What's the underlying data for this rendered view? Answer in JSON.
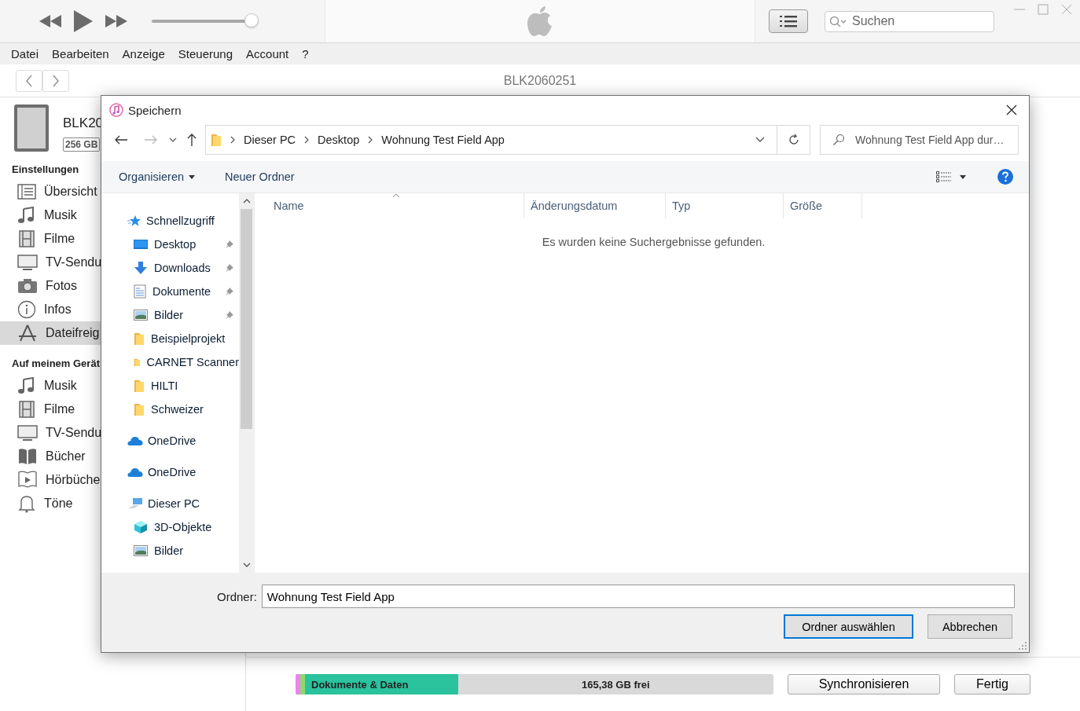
{
  "player": {
    "volume": {
      "level": 0.93
    }
  },
  "search": {
    "placeholder": "Suchen"
  },
  "menu": [
    "Datei",
    "Bearbeiten",
    "Anzeige",
    "Steuerung",
    "Account",
    "?"
  ],
  "nav": {
    "title": "BLK2060251"
  },
  "device": {
    "name": "BLK20",
    "capacity": "256 GB"
  },
  "sidebar": {
    "sections": [
      {
        "heading": "Einstellungen",
        "items": [
          {
            "label": "Übersicht",
            "kind": "summary",
            "selected": false
          },
          {
            "label": "Musik",
            "kind": "music",
            "selected": false
          },
          {
            "label": "Filme",
            "kind": "film",
            "selected": false
          },
          {
            "label": "TV-Sendu",
            "kind": "tv",
            "selected": false
          },
          {
            "label": "Fotos",
            "kind": "camera",
            "selected": false
          },
          {
            "label": "Infos",
            "kind": "info",
            "selected": false
          },
          {
            "label": "Dateifreig",
            "kind": "apps",
            "selected": true
          }
        ]
      },
      {
        "heading": "Auf meinem Gerät",
        "items": [
          {
            "label": "Musik",
            "kind": "music",
            "selected": false
          },
          {
            "label": "Filme",
            "kind": "film",
            "selected": false
          },
          {
            "label": "TV-Sendu",
            "kind": "tv",
            "selected": false
          },
          {
            "label": "Bücher",
            "kind": "book",
            "selected": false
          },
          {
            "label": "Hörbüche",
            "kind": "audiobook",
            "selected": false
          },
          {
            "label": "Töne",
            "kind": "bell",
            "selected": false
          }
        ]
      }
    ]
  },
  "storage": {
    "segments": [
      {
        "color": "#ee82ee",
        "level": 0.01
      },
      {
        "color": "#8fd86e",
        "level": 0.02
      },
      {
        "color": "#2bc39d",
        "level": 0.34,
        "label": "Dokumente & Daten"
      }
    ],
    "free": "165,38 GB frei"
  },
  "footer_buttons": [
    "Synchronisieren",
    "Fertig"
  ],
  "dialog": {
    "title": "Speichern",
    "path": [
      "Dieser PC",
      "Desktop",
      "Wohnung Test Field App"
    ],
    "search_placeholder": "Wohnung Test Field App dur…",
    "organize": "Organisieren",
    "new_folder": "Neuer Ordner",
    "tree": [
      {
        "label": "Schnellzugriff",
        "kind": "star",
        "children": [
          {
            "label": "Desktop",
            "kind": "desktop",
            "pinned": true
          },
          {
            "label": "Downloads",
            "kind": "download",
            "pinned": true
          },
          {
            "label": "Dokumente",
            "kind": "document",
            "pinned": true
          },
          {
            "label": "Bilder",
            "kind": "pictures",
            "pinned": true
          },
          {
            "label": "Beispielprojekt",
            "kind": "folder",
            "pinned": false
          },
          {
            "label": "CARNET Scanner",
            "kind": "folder",
            "pinned": false
          },
          {
            "label": "HILTI",
            "kind": "folder",
            "pinned": false
          },
          {
            "label": "Schweizer",
            "kind": "folder",
            "pinned": false
          }
        ]
      },
      {
        "label": "OneDrive",
        "kind": "cloud"
      },
      {
        "label": "OneDrive",
        "kind": "cloud"
      },
      {
        "label": "Dieser PC",
        "kind": "pc",
        "children": [
          {
            "label": "3D-Objekte",
            "kind": "cube",
            "pinned": false
          },
          {
            "label": "Bilder",
            "kind": "pictures",
            "pinned": false
          }
        ]
      }
    ],
    "columns": [
      {
        "label": "Name",
        "sorted": true
      },
      {
        "label": "Änderungsdatum",
        "sorted": false
      },
      {
        "label": "Typ",
        "sorted": false
      },
      {
        "label": "Größe",
        "sorted": false
      }
    ],
    "empty_message": "Es wurden keine Suchergebnisse gefunden.",
    "folder": {
      "label": "Ordner:",
      "value": "Wohnung Test Field App"
    },
    "buttons": [
      {
        "label": "Ordner auswählen",
        "default": true
      },
      {
        "label": "Abbrechen",
        "default": false
      }
    ]
  }
}
